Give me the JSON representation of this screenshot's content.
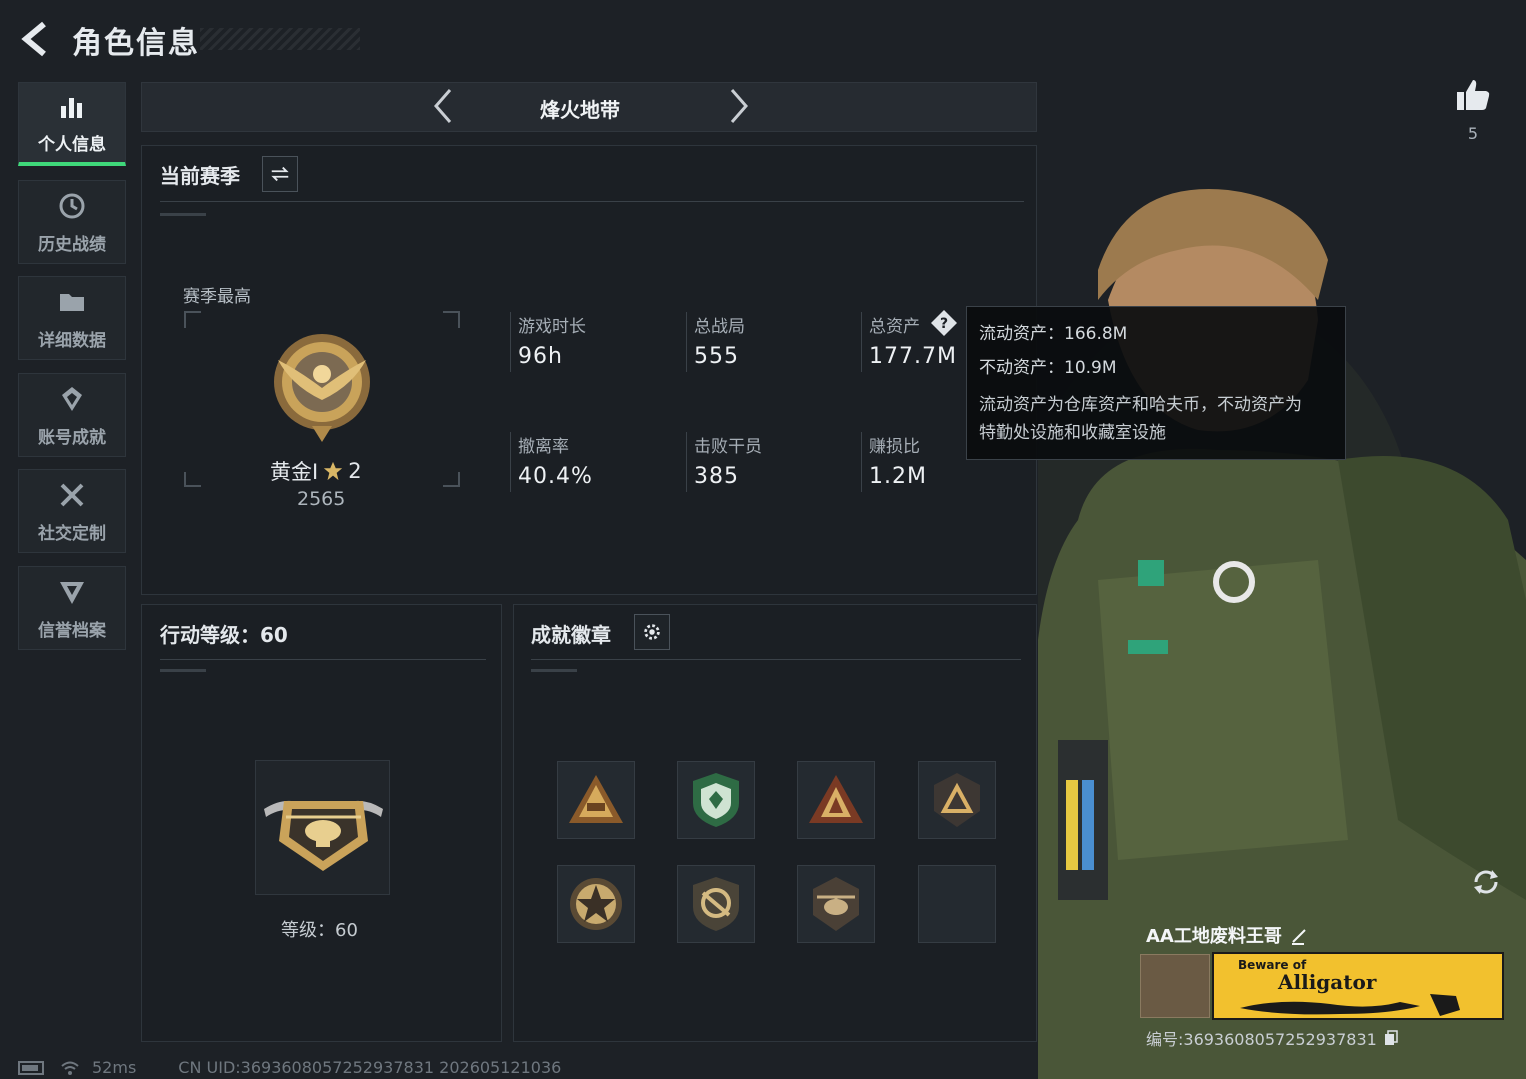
{
  "header": {
    "title": "角色信息"
  },
  "sidebar": {
    "items": [
      {
        "label": "个人信息",
        "icon": "bar-chart-icon",
        "active": true
      },
      {
        "label": "历史战绩",
        "icon": "history-clock-icon",
        "active": false
      },
      {
        "label": "详细数据",
        "icon": "folder-icon",
        "active": false
      },
      {
        "label": "账号成就",
        "icon": "achievement-icon",
        "active": false
      },
      {
        "label": "社交定制",
        "icon": "tools-icon",
        "active": false
      },
      {
        "label": "信誉档案",
        "icon": "reputation-icon",
        "active": false
      }
    ]
  },
  "mode": {
    "name": "烽火地带"
  },
  "season": {
    "title": "当前赛季",
    "best_label": "赛季最高",
    "rank_name": "黄金Ⅰ",
    "rank_stars": "2",
    "rank_score": "2565",
    "stats": [
      {
        "label": "游戏时长",
        "value": "96h"
      },
      {
        "label": "总战局",
        "value": "555"
      },
      {
        "label": "总资产",
        "value": "177.7M"
      },
      {
        "label": "撤离率",
        "value": "40.4%"
      },
      {
        "label": "击败干员",
        "value": "385"
      },
      {
        "label": "赚损比",
        "value": "1.2M"
      }
    ]
  },
  "tooltip": {
    "liquid": "流动资产：166.8M",
    "fixed": "不动资产：10.9M",
    "desc_1": "流动资产为仓库资产和哈夫币，不动资产为",
    "desc_2": "特勤处设施和收藏室设施"
  },
  "level": {
    "title": "行动等级：60",
    "text": "等级：60"
  },
  "badges": {
    "title": "成就徽章",
    "items": [
      "badge-triangle-gold",
      "badge-shield-green",
      "badge-mountain-gold",
      "badge-triangle-dark",
      "badge-star-round",
      "badge-shield-arrow",
      "badge-helicopter",
      "badge-empty"
    ]
  },
  "likes": {
    "count": "5"
  },
  "player": {
    "name": "AA工地废料王哥",
    "banner_small": "Beware of",
    "banner_big": "Alligator",
    "id": "编号:3693608057252937831"
  },
  "footer": {
    "ping": "52ms",
    "uid": "CN UID:3693608057252937831 202605121036"
  },
  "colors": {
    "accent_green": "#3fd87a",
    "gold": "#c9a35a",
    "banner_yellow": "#f2c12e"
  }
}
